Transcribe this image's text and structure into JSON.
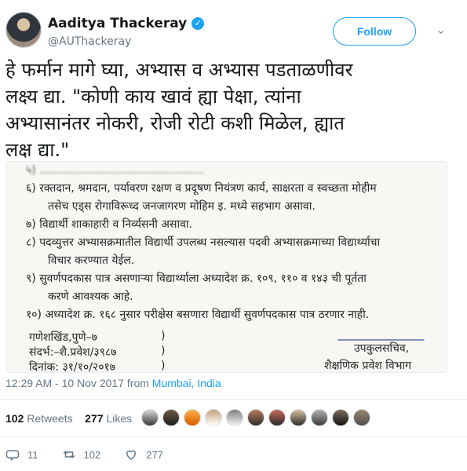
{
  "user": {
    "display_name": "Aaditya Thackeray",
    "handle": "@AUThackeray",
    "follow_label": "Follow"
  },
  "tweet": {
    "text_lines": [
      "हे फर्मान मागे घ्या, अभ्यास व अभ्यास पडताळणीवर",
      "लक्ष्य द्या. \"कोणी काय खावं ह्या पेक्षा, त्यांना",
      "अभ्यासानंतर नोकरी, रोजी रोटी कशी मिळेल, ह्यात",
      "लक्ष द्या.\""
    ],
    "document": {
      "blurred_top": "५) ...............................................",
      "line_1": "६) रक्तदान, श्रमदान, पर्यावरण रक्षण व प्रदूषण नियंत्रण कार्य, साक्षरता व स्वच्छता मोहीम",
      "line_2": "तसेच एड्स रोगाविरूध्द जनजागरण मोहिम इ. मध्ये सहभाग असावा.",
      "line_3": "७) विद्यार्थी शाकाहारी व निर्व्यसनी असावा.",
      "line_4": "८) पदव्युत्तर अभ्यासक्रमातील विद्यार्थी उपलब्ध नसल्यास पदवी अभ्यासक्रमाच्या विद्यार्थ्याचा",
      "line_5": "विचार करण्यात येईल.",
      "line_6": "९) सुवर्णपदकास पात्र असणाऱ्या विद्यार्थ्याला अध्यादेश क्र. १०९, ११० व १४३ ची  पूर्तता",
      "line_7": "करणे आवश्यक आहे.",
      "line_8": "१०) अध्यादेश क्र. १६८ नुसार परीक्षेस बसणारा विद्यार्थी सुवर्णपदकास पात्र ठरणार नाही.",
      "place": "गणेशखिंड,पुणे–७",
      "ref": "संदर्भ:–शै.प्रवेश/३९८७",
      "date": "दिनांक: ३१/१०/२०१७",
      "paren_1": ")",
      "paren_2": ")",
      "paren_3": ")",
      "title_1": "उपकुलसचिव,",
      "title_2": "शैक्षणिक प्रवेश विभाग"
    },
    "time": "12:29 AM - 10 Nov 2017",
    "from_label": "from",
    "location": "Mumbai, India"
  },
  "stats": {
    "retweets_count": "102",
    "retweets_label": "Retweets",
    "likes_count": "277",
    "likes_label": "Likes"
  },
  "actions": {
    "reply_count": "11",
    "retweet_count": "102",
    "like_count": "277"
  },
  "colors": {
    "brand": "#1da1f2",
    "muted": "#657786"
  },
  "icons": [
    "verified-badge-icon",
    "chevron-down-icon",
    "reply-icon",
    "retweet-icon",
    "like-icon"
  ]
}
